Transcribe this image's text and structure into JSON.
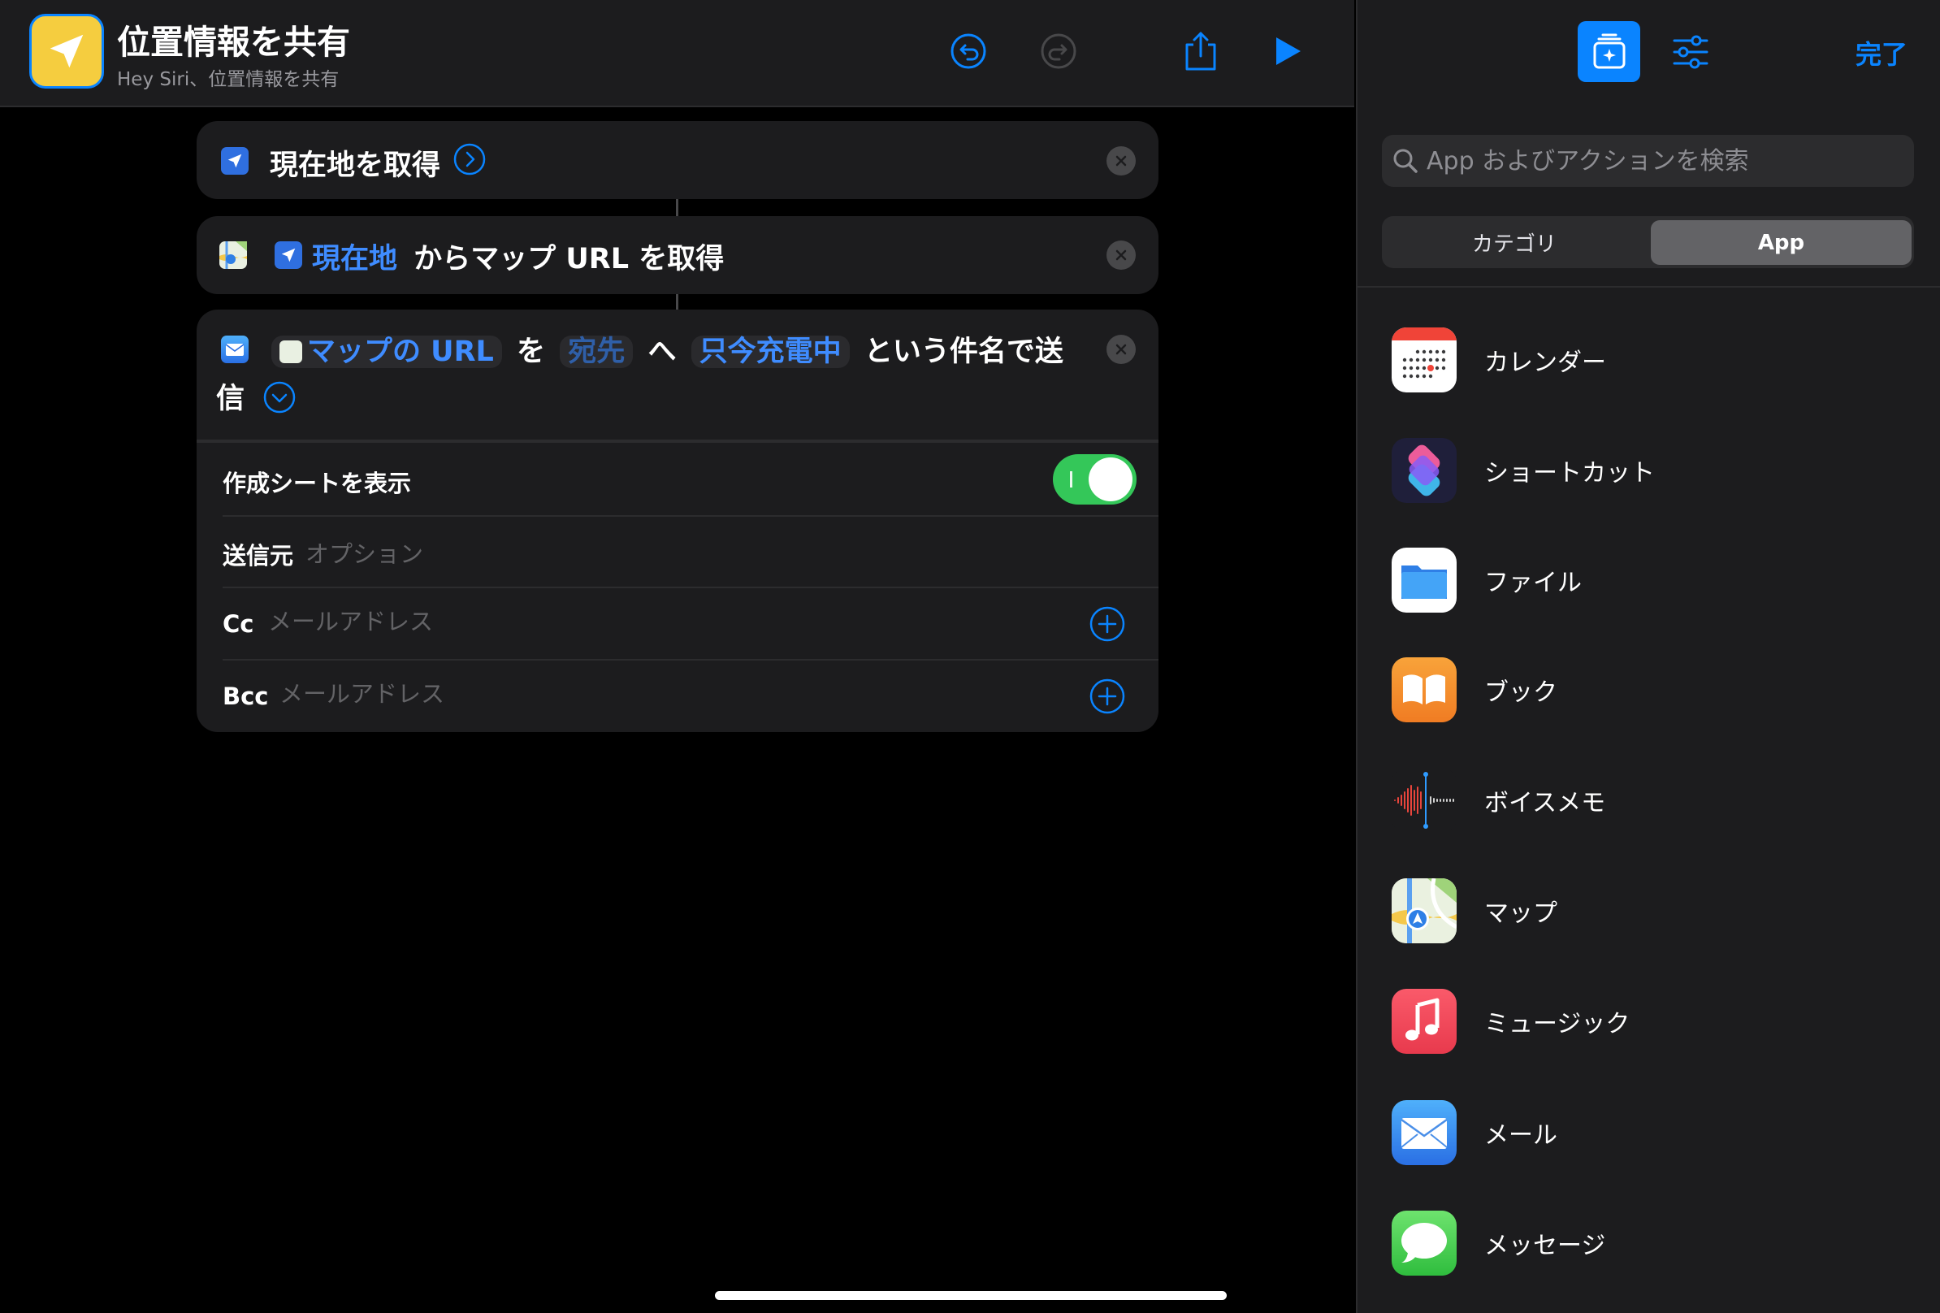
{
  "header": {
    "title": "位置情報を共有",
    "subtitle": "Hey Siri、位置情報を共有"
  },
  "actions": {
    "get_location": {
      "label": "現在地を取得"
    },
    "maps_url": {
      "token": "現在地",
      "text": "からマップ URL を取得"
    },
    "send_mail": {
      "token_url": "マップの URL",
      "word_wo": "を",
      "token_to": "宛先",
      "word_he": "へ",
      "token_subject": "只今充電中",
      "text_tail": "という件名で送",
      "text_wrap": "信",
      "show_compose_label": "作成シートを表示",
      "show_compose_on": true,
      "from_label": "送信元",
      "from_placeholder": "オプション",
      "cc_label": "Cc",
      "cc_placeholder": "メールアドレス",
      "bcc_label": "Bcc",
      "bcc_placeholder": "メールアドレス"
    }
  },
  "panel": {
    "done_label": "完了",
    "search_placeholder": "App およびアクションを検索",
    "segments": {
      "category": "カテゴリ",
      "app": "App",
      "selected": "App"
    },
    "apps": [
      {
        "label": "カレンダー",
        "icon": "calendar-app-icon"
      },
      {
        "label": "ショートカット",
        "icon": "shortcuts-app-icon"
      },
      {
        "label": "ファイル",
        "icon": "files-app-icon"
      },
      {
        "label": "ブック",
        "icon": "books-app-icon"
      },
      {
        "label": "ボイスメモ",
        "icon": "voice-memos-app-icon"
      },
      {
        "label": "マップ",
        "icon": "maps-app-icon"
      },
      {
        "label": "ミュージック",
        "icon": "music-app-icon"
      },
      {
        "label": "メール",
        "icon": "mail-app-icon"
      },
      {
        "label": "メッセージ",
        "icon": "messages-app-icon"
      }
    ]
  },
  "colors": {
    "accent": "#0a84ff",
    "toggle_on": "#34c759",
    "shortcut_icon_bg": "#f5cd3f"
  }
}
